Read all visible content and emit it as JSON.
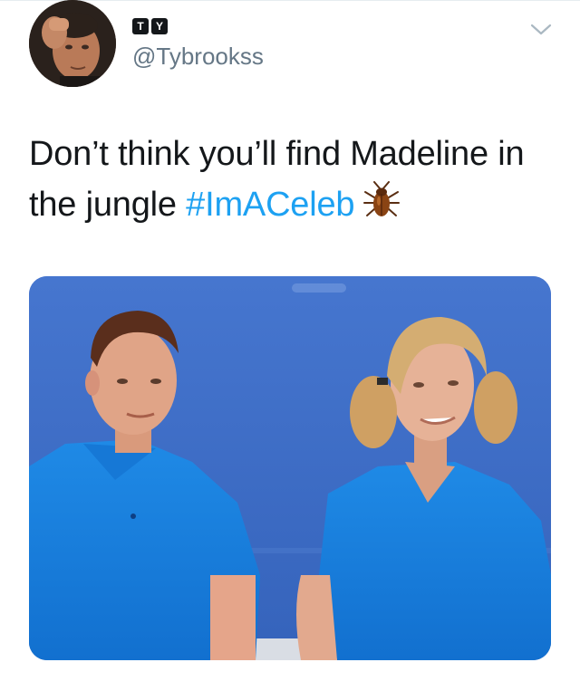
{
  "tweet": {
    "author": {
      "display_name_badges": [
        "T",
        "Y"
      ],
      "handle": "@Tybrookss"
    },
    "text_plain": "Don’t think you’ll find Madeline in the jungle ",
    "hashtag": "#ImACeleb",
    "emoji": "cockroach-emoji",
    "menu_icon": "chevron-down-icon"
  },
  "colors": {
    "text": "#14171a",
    "secondary": "#657786",
    "link": "#1da1f2",
    "divider": "#e6ecf0"
  }
}
